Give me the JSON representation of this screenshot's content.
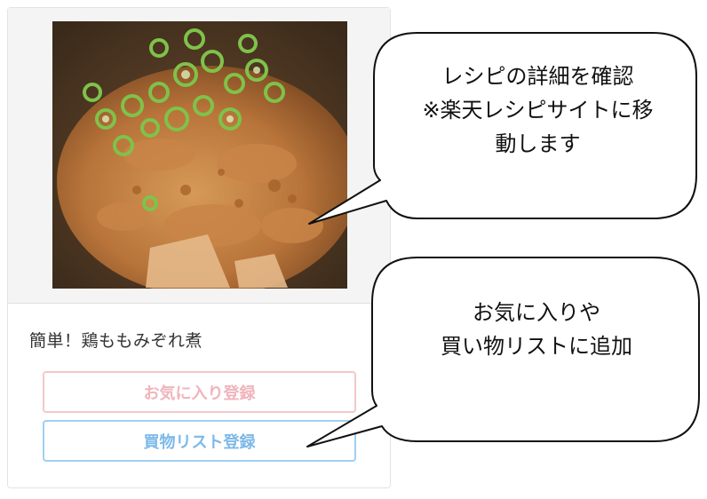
{
  "recipe_card": {
    "photo_label": "鶏もものみぞれ煮の写真",
    "title": "簡単！鶏ももみぞれ煮",
    "favorite_button_label": "お気に入り登録",
    "shopping_list_button_label": "買物リスト登録"
  },
  "callouts": {
    "details": {
      "lines": [
        "レシピの詳細を確認",
        "※楽天レシピサイトに移",
        "動します"
      ]
    },
    "actions": {
      "lines": [
        "お気に入りや",
        "買い物リストに追加"
      ]
    }
  },
  "colors": {
    "favorite_border": "#f3c7cd",
    "favorite_text": "#f0b4bc",
    "list_border": "#9fd0f3",
    "list_text": "#7db9e8",
    "card_border": "#e3e3e3",
    "photo_background": "#f4f4f4"
  },
  "icons": {
    "details_pointer": "speech-bubble-tail",
    "actions_pointer": "speech-bubble-tail"
  }
}
